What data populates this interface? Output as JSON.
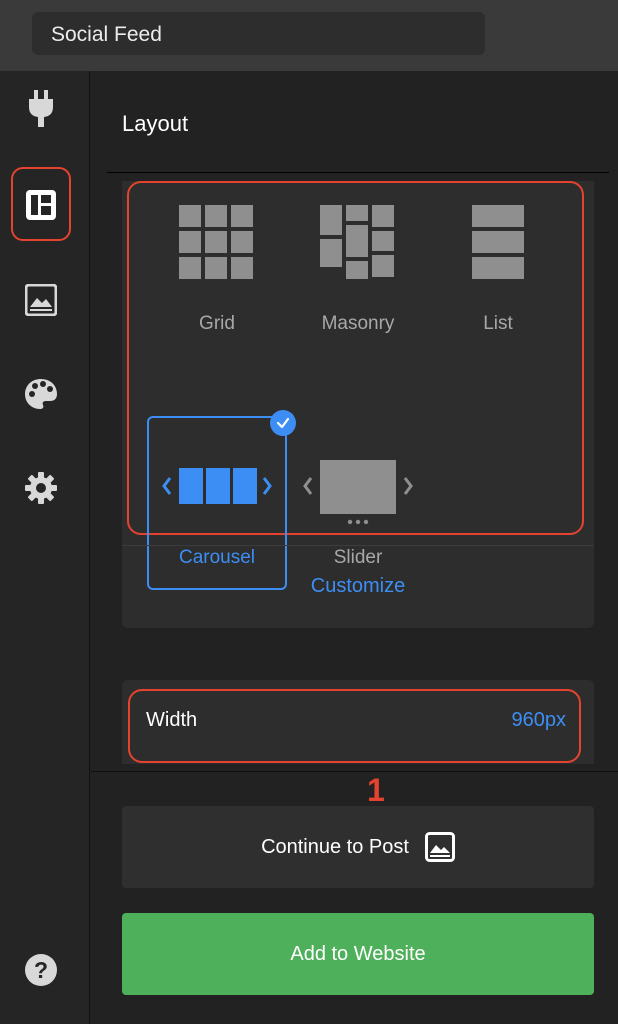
{
  "header": {
    "title": "Social Feed"
  },
  "sidebar": {
    "items": [
      {
        "icon": "plug-icon"
      },
      {
        "icon": "layout-icon",
        "active": true
      },
      {
        "icon": "image-icon"
      },
      {
        "icon": "palette-icon"
      },
      {
        "icon": "gear-icon"
      }
    ],
    "help_icon": "help-icon",
    "help_label": "?"
  },
  "layout": {
    "title": "Layout",
    "options": [
      {
        "label": "Grid",
        "selected": false
      },
      {
        "label": "Masonry",
        "selected": false
      },
      {
        "label": "List",
        "selected": false
      },
      {
        "label": "Carousel",
        "selected": true
      },
      {
        "label": "Slider",
        "selected": false
      }
    ],
    "customize_label": "Customize"
  },
  "width": {
    "label": "Width",
    "value": "960px"
  },
  "annotation": {
    "number": "1"
  },
  "buttons": {
    "continue_label": "Continue to Post",
    "add_label": "Add to Website"
  },
  "colors": {
    "accent": "#3d8ef4",
    "highlight": "#e4432f",
    "success": "#4fb05b"
  }
}
